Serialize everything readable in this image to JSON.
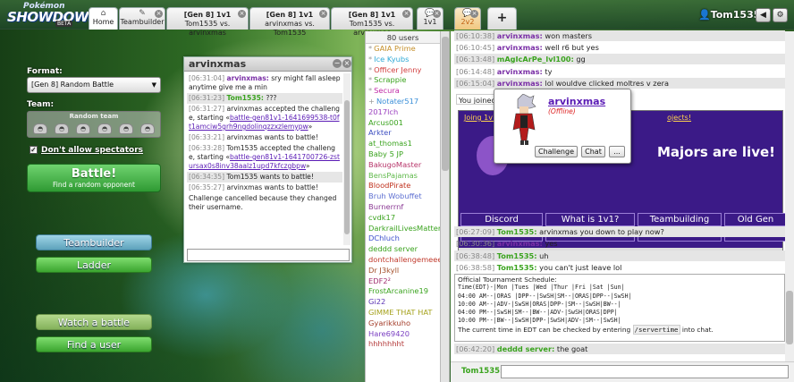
{
  "topbar": {
    "logo": {
      "top": "Pokémon",
      "main": "SHOWDOWN!",
      "badge": "BETA"
    },
    "tabs": [
      {
        "label": "Home",
        "icon": "home"
      },
      {
        "label": "Teambuilder",
        "icon": "pencil"
      },
      {
        "line1": "[Gen 8] 1v1",
        "line2": "Tom1535 vs. arvinxmas"
      },
      {
        "line1": "[Gen 8] 1v1",
        "line2": "arvinxmas vs. Tom1535"
      },
      {
        "line1": "[Gen 8] 1v1",
        "line2": "Tom1535 vs. arvinxmas"
      },
      {
        "label": "1v1",
        "icon": "chat-bubble"
      },
      {
        "label": "2v2",
        "icon": "chat-bubble"
      },
      {
        "label": "+"
      }
    ],
    "username": "Tom1535",
    "sound_icon": "◀",
    "settings_icon": "⚙"
  },
  "mainmenu": {
    "format_label": "Format:",
    "format_value": "[Gen 8] Random Battle",
    "team_label": "Team:",
    "team_value": "Random team",
    "spectators_label": "Don't allow spectators",
    "battle_label": "Battle!",
    "battle_sub": "Find a random opponent",
    "teambuilder": "Teambuilder",
    "ladder": "Ladder",
    "watch": "Watch a battle",
    "finduser": "Find a user"
  },
  "pm": {
    "title": "arvinxmas",
    "messages": [
      {
        "ts": "[06:31:04]",
        "user": "arvinxmas:",
        "cls": "u1",
        "text": " sry might fall asleep anytime give me a min"
      },
      {
        "ts": "[06:31:23]",
        "user": "Tom1535:",
        "cls": "u2",
        "text": " ???",
        "hl": true
      },
      {
        "ts": "[06:31:27]",
        "text": " arvinxmas accepted the challenge, starting «",
        "link": "battle-gen81v1-1641699538-t0ft1amciw5grh9ngdolinqzzxzlemypw",
        "after": "»"
      },
      {
        "ts": "[06:33:21]",
        "text": " arvinxmas wants to battle!"
      },
      {
        "ts": "[06:33:28]",
        "text": " Tom1535 accepted the challenge, starting «",
        "link": "battle-gen81v1-1641700726-zstursax0s8inv38aalz1upd7kfczgbpw",
        "after": "»"
      },
      {
        "ts": "[06:34:35]",
        "text": " Tom1535 wants to battle!",
        "hl": true
      },
      {
        "ts": "[06:35:27]",
        "text": " arvinxmas wants to battle!"
      },
      {
        "text": "Challenge cancelled because they changed their username."
      }
    ]
  },
  "userlist": {
    "count": "80 users",
    "users": [
      {
        "sym": "*",
        "name": "GAIA Prime",
        "color": "#c48f2a"
      },
      {
        "sym": "*",
        "name": "Ice Kyubs",
        "color": "#2fa9d6"
      },
      {
        "sym": "*",
        "name": "Officer Jenny",
        "color": "#d13d3d"
      },
      {
        "sym": "*",
        "name": "Scrappie",
        "color": "#3aa31e"
      },
      {
        "sym": "*",
        "name": "Secura",
        "color": "#c02aa6"
      },
      {
        "sym": "+",
        "name": "Notater517",
        "color": "#3b8fd8"
      },
      {
        "name": "2017lch",
        "color": "#9a3fbf"
      },
      {
        "name": "Arcus001",
        "color": "#3aa31e"
      },
      {
        "name": "Arkter",
        "color": "#3c4ec0"
      },
      {
        "name": "at_thomas1",
        "color": "#3aa31e"
      },
      {
        "name": "Baby 5 JP",
        "color": "#3aa31e"
      },
      {
        "name": "BakugoMaster",
        "color": "#b7356a"
      },
      {
        "name": "BensPajamas",
        "color": "#5fb94a"
      },
      {
        "name": "BloodPirate",
        "color": "#c0311d"
      },
      {
        "name": "Bruh Wobuffet",
        "color": "#5d6fd1"
      },
      {
        "name": "Burnerrnf",
        "color": "#8b3a94"
      },
      {
        "name": "cvdk17",
        "color": "#3aa31e"
      },
      {
        "name": "DarkrailLivesMatter",
        "color": "#3aa31e"
      },
      {
        "name": "DChluch",
        "color": "#3b4ecc"
      },
      {
        "name": "deddd server",
        "color": "#3aa31e"
      },
      {
        "name": "dontchallengemeee",
        "color": "#c0392b"
      },
      {
        "name": "Dr J3kyll",
        "color": "#a34f2a"
      },
      {
        "name": "EDF2²",
        "color": "#a12f70"
      },
      {
        "name": "FrostArcanine19",
        "color": "#3aa31e"
      },
      {
        "name": "Gi22",
        "color": "#5d35b5"
      },
      {
        "name": "GIMME THAT HAT",
        "color": "#a5a21d"
      },
      {
        "name": "Gyarikkuho",
        "color": "#a43d2a"
      },
      {
        "name": "Hare69420",
        "color": "#7a3fc2"
      },
      {
        "name": "hhhhhhht",
        "color": "#b33a3a"
      }
    ]
  },
  "chat": {
    "top_lines": [
      {
        "ts": "[06:10:38]",
        "user": "arvinxmas:",
        "cls": "u1",
        "text": "won masters",
        "hl": true
      },
      {
        "ts": "[06:10:45]",
        "user": "arvinxmas:",
        "cls": "u1",
        "text": "well r6 but yes"
      },
      {
        "ts": "[06:13:48]",
        "user": "mAgIcArPe_lvl100:",
        "cls": "u2",
        "text": "gg",
        "hl": true
      },
      {
        "ts": "[06:14:48]",
        "user": "arvinxmas:",
        "cls": "u1",
        "text": "ty"
      },
      {
        "ts": "[06:15:04]",
        "user": "arvinxmas:",
        "cls": "u1",
        "text": "lol wouldve clicked moltres v zera",
        "hl": true
      }
    ],
    "joined": "You joined",
    "announce_link": "Joing 1v1",
    "announce_link2": "ojects!",
    "majors": "Majors are live!",
    "nav_row1": [
      "Discord",
      "What is 1v1?",
      "Teambuilding",
      "Old Gen"
    ],
    "nav_row2": [
      "Events",
      "Resources",
      "Subforum",
      "Official"
    ],
    "mid_lines": [
      {
        "ts": "[06:27:09]",
        "user": "Tom1535:",
        "cls": "u2",
        "text": "arvinxmas you down to play now?",
        "hl": true
      },
      {
        "ts": "[06:30:36]",
        "user": "arvinxmas:",
        "cls": "u1",
        "text": "yes"
      },
      {
        "ts": "[06:38:48]",
        "user": "Tom1535:",
        "cls": "u2",
        "text": "uh",
        "hl": true
      },
      {
        "ts": "[06:38:58]",
        "user": "Tom1535:",
        "cls": "u2",
        "text": "you can't just leave lol"
      }
    ],
    "schedule": {
      "title": "Official Tournament Schedule:",
      "rows": [
        "Time(EDT)-|Mon |Tues |Wed |Thur |Fri |Sat |Sun|",
        "04:00 AM--|ORAS |DPP--|SwSH|SM--|ORAS|DPP--|SwSH|",
        "10:00 AM--|ADV-|SwSH|ORAS|DPP-|SM--|SwSH|BW--|",
        "04:00 PM--|SwSH|SM--|BW--|ADV-|SwSH|ORAS|DPP|",
        "10:00 PM--|BW--|SwSH|DPP-|SwSH|ADV-|SM--|SwSH|"
      ],
      "footer_pre": "The current time in EDT can be checked by entering ",
      "footer_code": "/servertime",
      "footer_post": " into chat."
    },
    "last": {
      "ts": "[06:42:20]",
      "user": "deddd server:",
      "cls": "u2",
      "text": "the goat",
      "hl": true
    },
    "input_name": "Tom1535:"
  },
  "popup": {
    "name": "arvinxmas",
    "status": "(Offline)",
    "buttons": [
      "Challenge",
      "Chat",
      "..."
    ]
  }
}
